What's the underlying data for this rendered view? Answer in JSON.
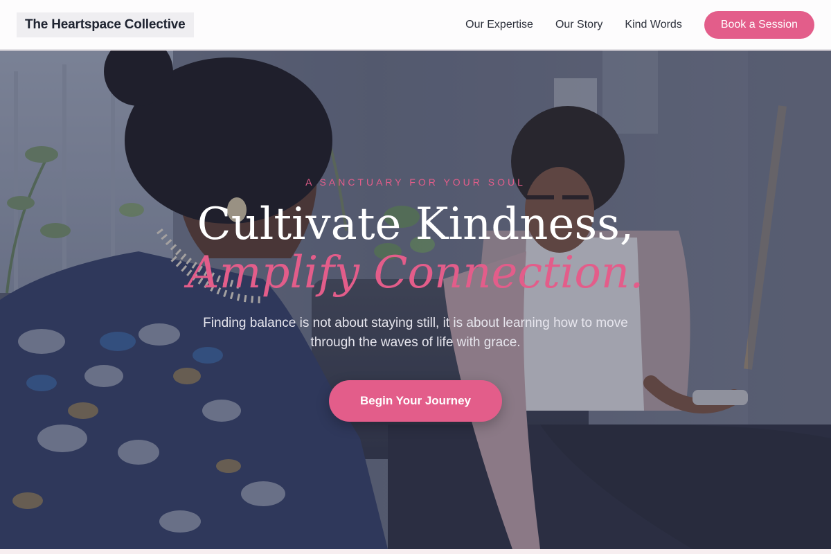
{
  "header": {
    "brand": "The Heartspace Collective",
    "nav": [
      "Our Expertise",
      "Our Story",
      "Kind Words"
    ],
    "cta": "Book a Session"
  },
  "hero": {
    "eyebrow": "A SANCTUARY FOR YOUR SOUL",
    "headline_line1": "Cultivate Kindness,",
    "headline_line2": "Amplify Connection.",
    "subtitle": "Finding balance is not about staying still, it is about learning how to move through the waves of life with grace.",
    "cta": "Begin Your Journey",
    "image": "photo of two women talking on a couch in a sunlit room"
  },
  "colors": {
    "accent": "#e35d8a",
    "nav_bg": "#fdfcfd",
    "brand_bg": "#efeef1",
    "text_dark": "#1e2330",
    "overlay": "#262a40"
  }
}
